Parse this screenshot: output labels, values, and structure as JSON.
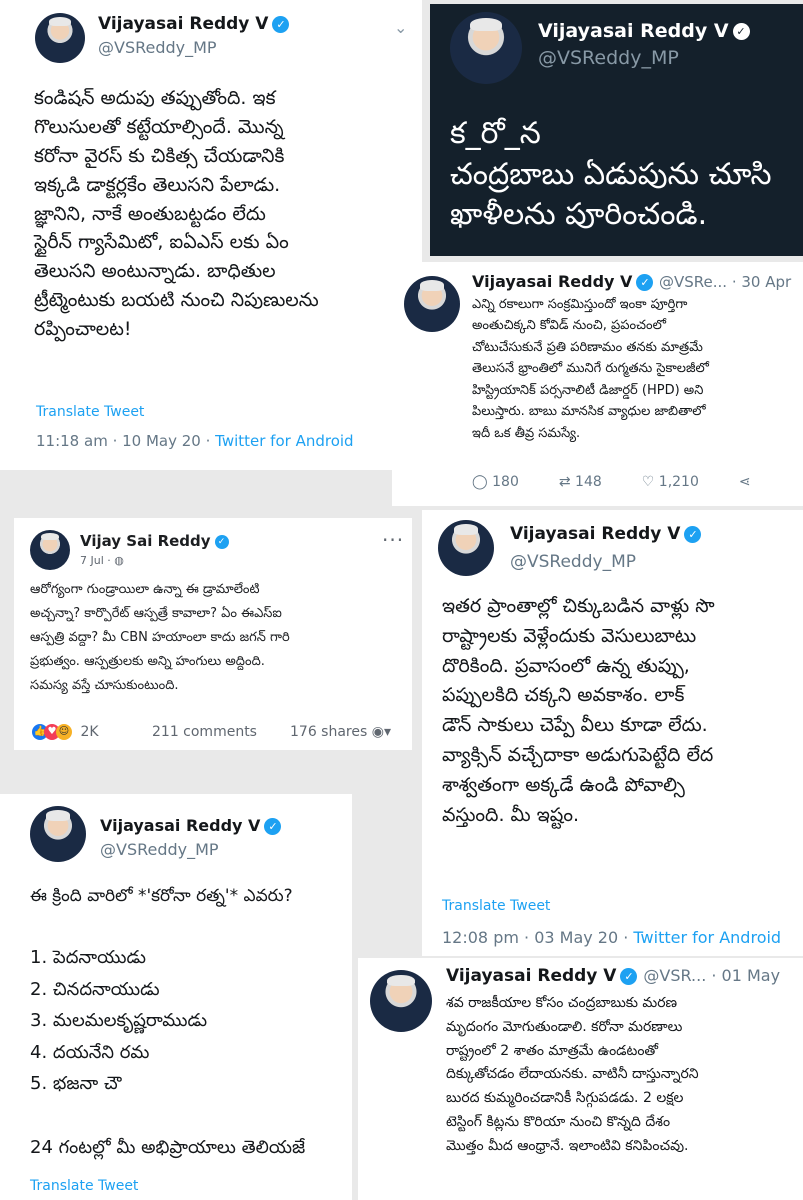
{
  "verified_mark": "✓",
  "card1": {
    "name": "Vijayasai Reddy V",
    "handle": "@VSReddy_MP",
    "lines": [
      "కండిషన్ అదుపు తప్పుతోంది. ఇక",
      "గొలుసులతో కట్టేయాల్సిందే. మొన్న",
      "కరోనా వైరస్ కు చికిత్స చేయడానికి",
      "ఇక్కడి డాక్టర్లకేం తెలుసని పేలాడు.",
      "జ్ఞానిని, నాకే అంతుబట్టడం లేదు",
      "స్టైరీన్ గ్యాసేమిటో, ఐఏఎస్ లకు ఏం",
      "తెలుసని అంటున్నాడు. బాధితుల",
      "ట్రీట్మెంటుకు బయటి నుంచి నిపుణులను",
      "రప్పించాలట!"
    ],
    "translate": "Translate Tweet",
    "time": "11:18 am · 10 May 20 · ",
    "source": "Twitter for Android"
  },
  "card2": {
    "name": "Vijayasai Reddy V",
    "handle": "@VSReddy_MP",
    "lines": [
      "క_రో_న",
      "చంద్రబాబు ఏడుపును చూసి",
      "ఖాళీలను పూరించండి."
    ]
  },
  "card3": {
    "name": "Vijayasai Reddy V",
    "handle_date": "@VSRe... · 30 Apr",
    "lines": [
      "ఎన్ని రకాలుగా సంక్రమిస్తుందో ఇంకా పూర్తిగా",
      "అంతుచిక్కని కోవిడ్ నుంచి, ప్రపంచంలో",
      "చోటుచేసుకునే ప్రతి పరిణామం తనకు మాత్రమే",
      "తెలుసనే భ్రాంతిలో మునిగే రుగ్మతను సైకాలజీలో",
      "హిస్ట్రియానిక్ పర్సనాలిటీ డిజార్డర్ (HPD) అని",
      "పిలుస్తారు. బాబు మానసిక వ్యాధుల జాబితాలో",
      "ఇదీ ఒక తీవ్ర సమస్యే."
    ],
    "replies": "180",
    "retweets": "148",
    "likes": "1,210"
  },
  "card4": {
    "name": "Vijay Sai Reddy",
    "date": "7 Jul · ",
    "lines": [
      "ఆరోగ్యంగా గుండ్రాయిలా ఉన్నా ఈ డ్రామాలేంటి",
      "అచ్చన్నా? కార్పొరేట్ ఆస్పత్రే కావాలా? ఏం ఈఎస్ఐ",
      "ఆస్పత్రి వద్దా? మీ CBN హయాంలా కాదు జగన్ గారి",
      "ప్రభుత్వం. ఆస్పత్రులకు అన్ని హంగులు అద్దింది.",
      "సమస్య వస్తే చూసుకుంటుంది."
    ],
    "reactions": "2K",
    "comments": "211 comments",
    "shares": "176 shares"
  },
  "card5": {
    "name": "Vijayasai Reddy V",
    "handle": "@VSReddy_MP",
    "lines": [
      "ఇతర ప్రాంతాల్లో చిక్కుబడిన వాళ్లు సొ",
      "రాష్ట్రాలకు వెళ్లేందుకు వెసులుబాటు",
      "దొరికింది. ప్రవాసంలో ఉన్న తుప్పు,",
      "పప్పులకిది చక్కని అవకాశం. లాక్",
      "డౌన్ సాకులు చెప్పే వీలు కూడా లేదు.",
      "వ్యాక్సిన్ వచ్చేదాకా అడుగుపెట్టేది లేద",
      "శాశ్వతంగా అక్కడే ఉండి పోవాల్సి",
      "వస్తుంది. మీ ఇష్టం."
    ],
    "translate": "Translate Tweet",
    "time": "12:08 pm · 03 May 20 · ",
    "source": "Twitter for Android"
  },
  "card6": {
    "name": "Vijayasai Reddy V",
    "handle": "@VSReddy_MP",
    "question": "ఈ క్రింది వారిలో  *'కరోనా రత్న'* ఎవరు?",
    "options": [
      "1. పెదనాయుడు",
      "2. చినదనాయుడు",
      "3. మలమలకృష్ణరాముడు",
      "4. దయనేని రమ",
      "5. భజనా చౌ"
    ],
    "footer": "24 గంటల్లో మీ అభిప్రాయాలు తెలియజే",
    "translate": "Translate Tweet"
  },
  "card7": {
    "name": "Vijayasai Reddy V",
    "handle_date": "@VSR... · 01 May",
    "lines": [
      "శవ రాజకీయాల కోసం చంద్రబాబుకు మరణ",
      "మృదంగం మోగుతుండాలి. కరోనా మరణాలు",
      "రాష్ట్రంలో 2 శాతం మాత్రమే ఉండటంతో",
      "దిక్కుతోచడం లేదాయనకు. వాటినీ దాస్తున్నారని",
      "బురద కుమ్మరించడానికీ సిగ్గుపడడు. 2 లక్షల",
      "టెస్టింగ్ కిట్లను కొరియా నుంచి కొన్నది దేశం",
      "మొత్తం మీద ఆంధ్రానే. ఇలాంటివి కనిపించవు."
    ]
  }
}
